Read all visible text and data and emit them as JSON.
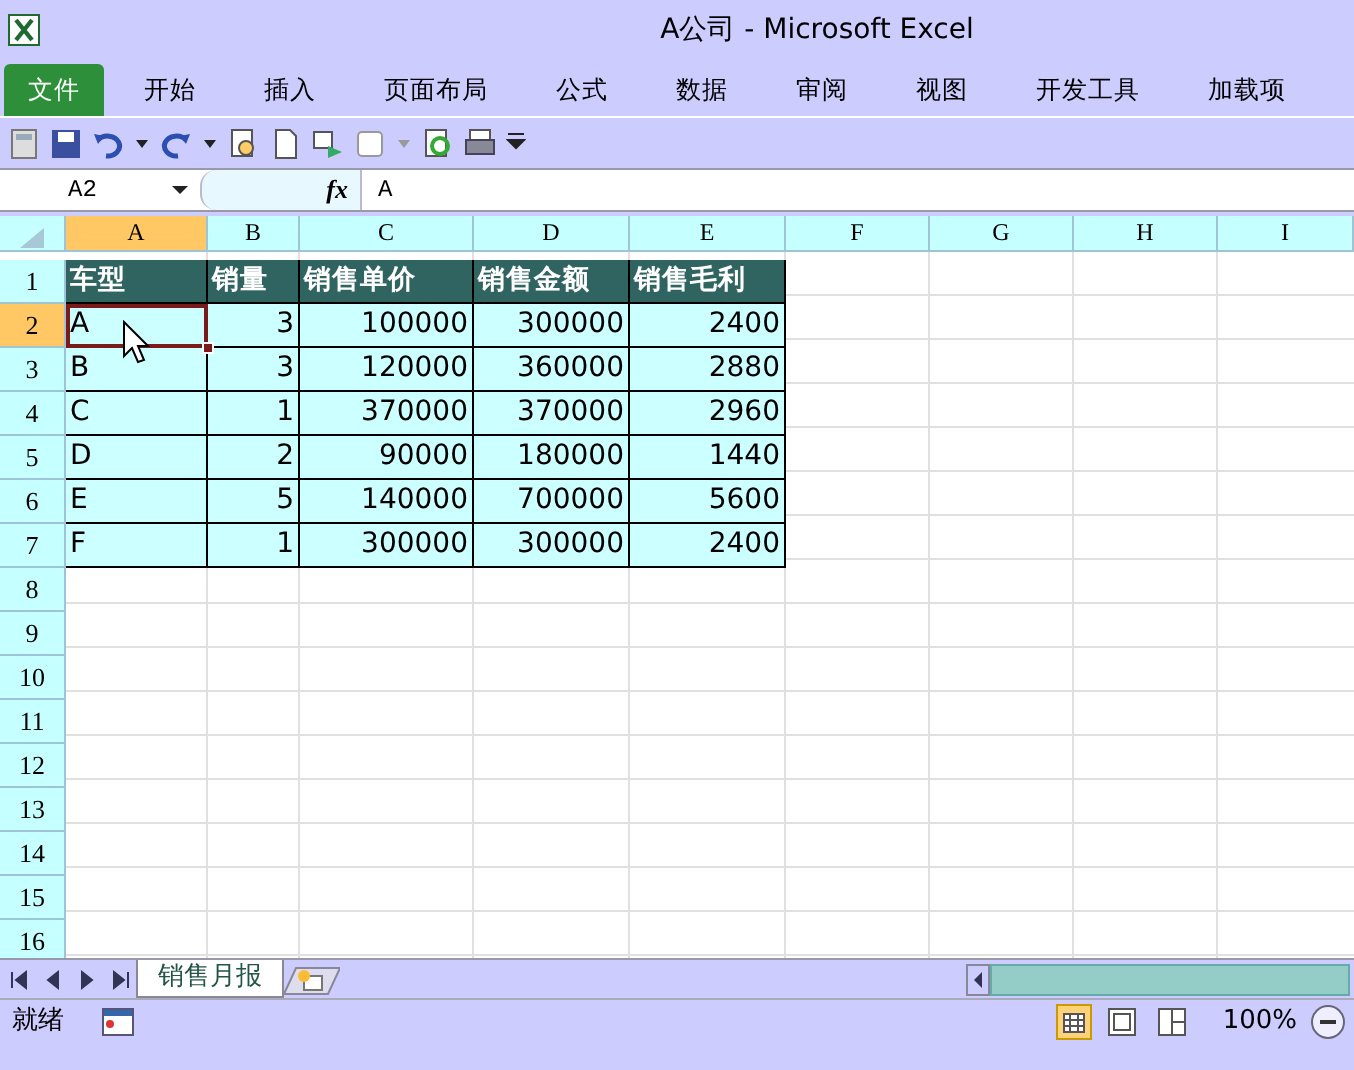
{
  "window": {
    "title": "A公司 - Microsoft Excel"
  },
  "ribbon_tabs": [
    {
      "label": "文件",
      "kind": "file"
    },
    {
      "label": "开始",
      "kind": "tab"
    },
    {
      "label": "插入",
      "kind": "tab"
    },
    {
      "label": "页面布局",
      "kind": "tab"
    },
    {
      "label": "公式",
      "kind": "tab"
    },
    {
      "label": "数据",
      "kind": "tab"
    },
    {
      "label": "审阅",
      "kind": "tab"
    },
    {
      "label": "视图",
      "kind": "tab"
    },
    {
      "label": "开发工具",
      "kind": "tab"
    },
    {
      "label": "加载项",
      "kind": "tab"
    }
  ],
  "formula_bar": {
    "name_box": "A2",
    "function_label": "fx",
    "value": "A"
  },
  "columns": [
    {
      "label": "A",
      "selected": true
    },
    {
      "label": "B",
      "selected": false
    },
    {
      "label": "C",
      "selected": false
    },
    {
      "label": "D",
      "selected": false
    },
    {
      "label": "E",
      "selected": false
    },
    {
      "label": "F",
      "selected": false
    },
    {
      "label": "G",
      "selected": false
    },
    {
      "label": "H",
      "selected": false
    },
    {
      "label": "I",
      "selected": false
    }
  ],
  "rows": [
    {
      "label": "1",
      "selected": false
    },
    {
      "label": "2",
      "selected": true
    },
    {
      "label": "3",
      "selected": false
    },
    {
      "label": "4",
      "selected": false
    },
    {
      "label": "5",
      "selected": false
    },
    {
      "label": "6",
      "selected": false
    },
    {
      "label": "7",
      "selected": false
    },
    {
      "label": "8",
      "selected": false
    },
    {
      "label": "9",
      "selected": false
    },
    {
      "label": "10",
      "selected": false
    },
    {
      "label": "11",
      "selected": false
    },
    {
      "label": "12",
      "selected": false
    },
    {
      "label": "13",
      "selected": false
    },
    {
      "label": "14",
      "selected": false
    },
    {
      "label": "15",
      "selected": false
    },
    {
      "label": "16",
      "selected": false
    }
  ],
  "table": {
    "header": [
      "车型",
      "销量",
      "销售单价",
      "销售金额",
      "销售毛利"
    ],
    "rows": [
      {
        "cells": [
          {
            "text": "A",
            "selected": true
          },
          {
            "text": "3",
            "selected": false
          },
          {
            "text": "100000",
            "selected": false
          },
          {
            "text": "300000",
            "selected": false
          },
          {
            "text": "2400",
            "selected": false
          }
        ]
      },
      {
        "cells": [
          {
            "text": "B",
            "selected": false
          },
          {
            "text": "3",
            "selected": false
          },
          {
            "text": "120000",
            "selected": false
          },
          {
            "text": "360000",
            "selected": false
          },
          {
            "text": "2880",
            "selected": false
          }
        ]
      },
      {
        "cells": [
          {
            "text": "C",
            "selected": false
          },
          {
            "text": "1",
            "selected": false
          },
          {
            "text": "370000",
            "selected": false
          },
          {
            "text": "370000",
            "selected": false
          },
          {
            "text": "2960",
            "selected": false
          }
        ]
      },
      {
        "cells": [
          {
            "text": "D",
            "selected": false
          },
          {
            "text": "2",
            "selected": false
          },
          {
            "text": "90000",
            "selected": false
          },
          {
            "text": "180000",
            "selected": false
          },
          {
            "text": "1440",
            "selected": false
          }
        ]
      },
      {
        "cells": [
          {
            "text": "E",
            "selected": false
          },
          {
            "text": "5",
            "selected": false
          },
          {
            "text": "140000",
            "selected": false
          },
          {
            "text": "700000",
            "selected": false
          },
          {
            "text": "5600",
            "selected": false
          }
        ]
      },
      {
        "cells": [
          {
            "text": "F",
            "selected": false
          },
          {
            "text": "1",
            "selected": false
          },
          {
            "text": "300000",
            "selected": false
          },
          {
            "text": "300000",
            "selected": false
          },
          {
            "text": "2400",
            "selected": false
          }
        ]
      }
    ]
  },
  "sheet_tabs": [
    {
      "label": "销售月报",
      "selected": true
    }
  ],
  "status_bar": {
    "status": "就绪",
    "zoom": "100%"
  }
}
